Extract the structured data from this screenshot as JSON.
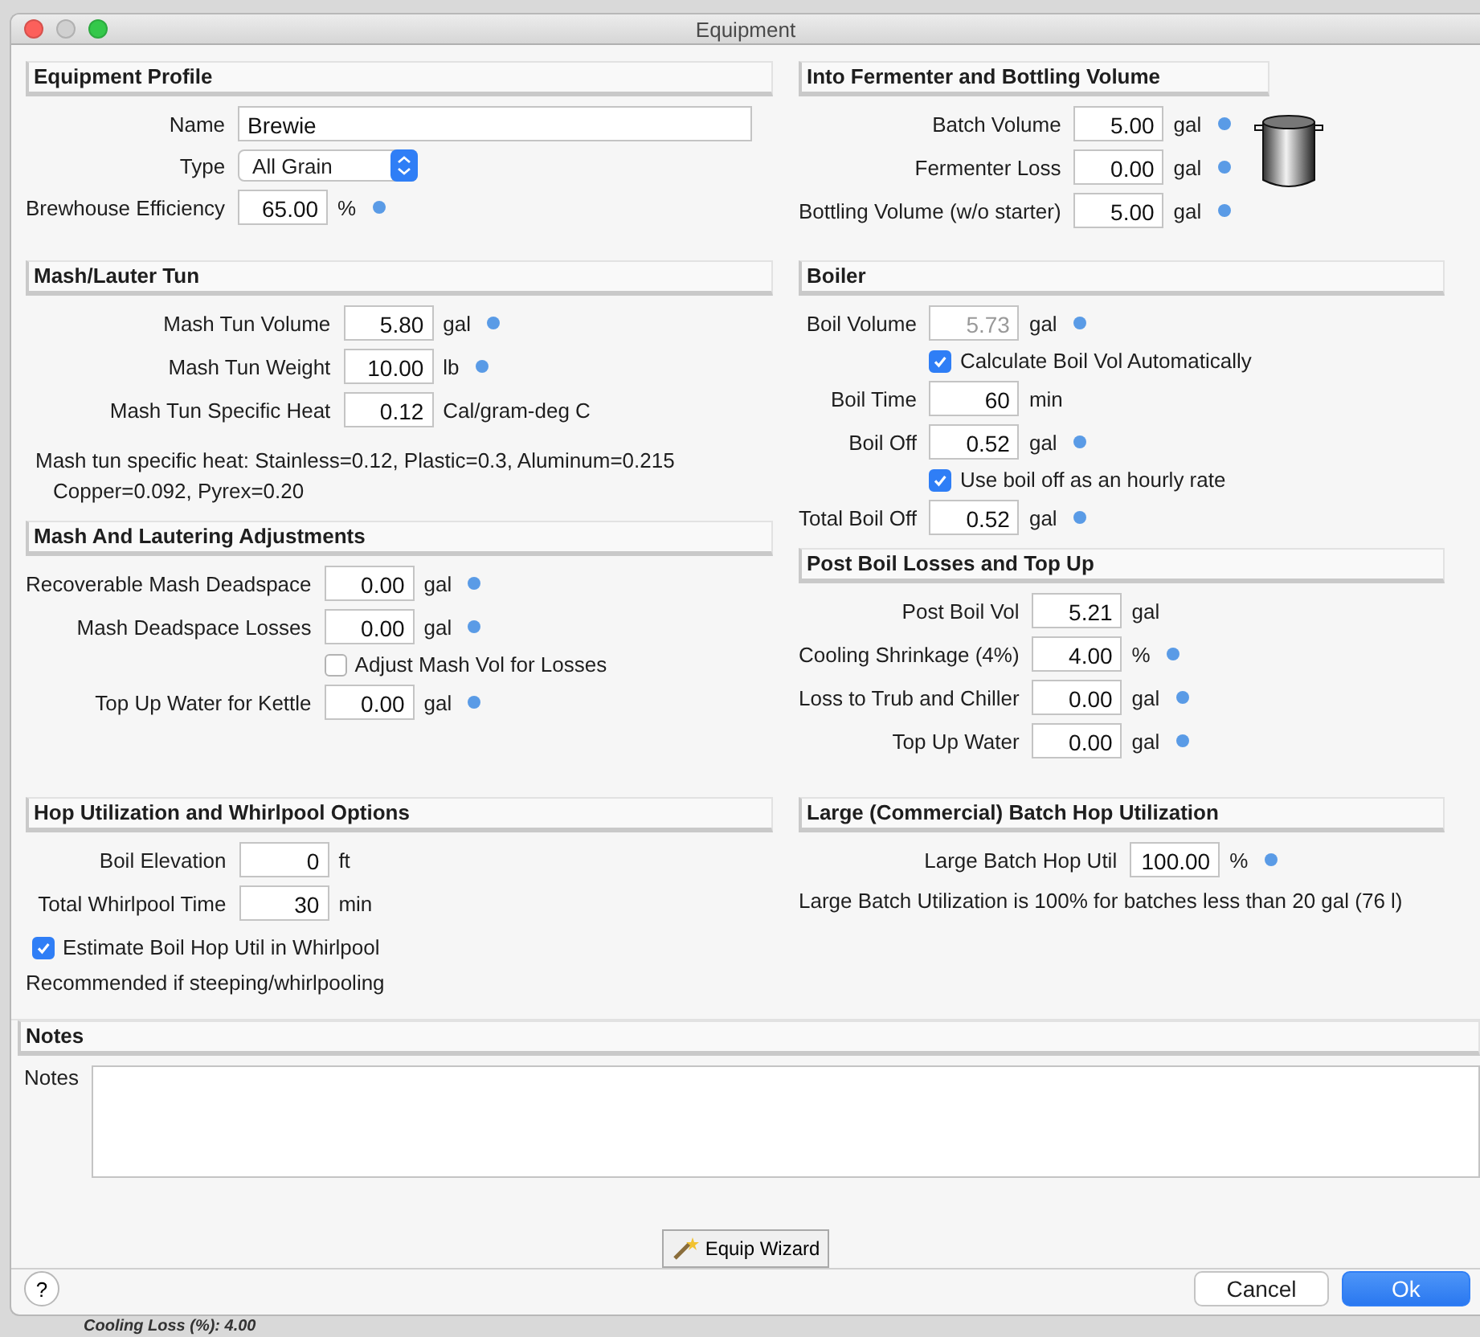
{
  "window": {
    "title": "Equipment"
  },
  "bands": [
    {
      "left": [
        {
          "title": "Equipment Profile",
          "kind": "plain",
          "rows": [
            {
              "kind": "text_field",
              "label": "Name",
              "value": "Brewie"
            },
            {
              "kind": "select",
              "label": "Type",
              "value": "All Grain"
            },
            {
              "kind": "field",
              "label": "Brewhouse Efficiency",
              "value": "65.00",
              "unit": "%",
              "dot": true,
              "disabled": false
            }
          ]
        }
      ],
      "right": [
        {
          "title": "Into Fermenter and Bottling Volume",
          "kind": "pot",
          "rows": [
            {
              "kind": "field",
              "label": "Batch Volume",
              "value": "5.00",
              "unit": "gal",
              "dot": true,
              "disabled": false
            },
            {
              "kind": "field",
              "label": "Fermenter Loss",
              "value": "0.00",
              "unit": "gal",
              "dot": true,
              "disabled": false
            },
            {
              "kind": "field",
              "label": "Bottling Volume (w/o starter)",
              "value": "5.00",
              "unit": "gal",
              "dot": true,
              "disabled": false
            }
          ]
        }
      ]
    },
    {
      "left": [
        {
          "title": "Mash/Lauter Tun",
          "kind": "plain",
          "rows": [
            {
              "kind": "field",
              "label": "Mash Tun Volume",
              "value": "5.80",
              "unit": "gal",
              "dot": true,
              "disabled": false
            },
            {
              "kind": "field",
              "label": "Mash Tun Weight",
              "value": "10.00",
              "unit": "lb",
              "dot": true,
              "disabled": false
            },
            {
              "kind": "field",
              "label": "Mash Tun Specific Heat",
              "value": "0.12",
              "unit": "Cal/gram-deg C",
              "dot": false,
              "disabled": false
            },
            {
              "kind": "note",
              "text": "Mash tun specific heat: Stainless=0.12, Plastic=0.3, Aluminum=0.215"
            },
            {
              "kind": "note",
              "text": "Copper=0.092, Pyrex=0.20"
            }
          ]
        },
        {
          "title": "Mash And Lautering Adjustments",
          "kind": "plain",
          "rows": [
            {
              "kind": "field",
              "label": "Recoverable Mash Deadspace",
              "value": "0.00",
              "unit": "gal",
              "dot": true,
              "disabled": false
            },
            {
              "kind": "field",
              "label": "Mash Deadspace Losses",
              "value": "0.00",
              "unit": "gal",
              "dot": true,
              "disabled": false
            },
            {
              "kind": "checkbox",
              "label": "Adjust Mash Vol for Losses",
              "checked": false
            },
            {
              "kind": "field",
              "label": "Top Up Water for Kettle",
              "value": "0.00",
              "unit": "gal",
              "dot": true,
              "disabled": false
            }
          ]
        }
      ],
      "right": [
        {
          "title": "Boiler",
          "kind": "plain",
          "rows": [
            {
              "kind": "field",
              "label": "Boil Volume",
              "value": "5.73",
              "unit": "gal",
              "dot": true,
              "disabled": true
            },
            {
              "kind": "checkbox",
              "label": "Calculate Boil Vol Automatically",
              "checked": true
            },
            {
              "kind": "field",
              "label": "Boil Time",
              "value": "60",
              "unit": "min",
              "dot": false,
              "disabled": false
            },
            {
              "kind": "field",
              "label": "Boil Off",
              "value": "0.52",
              "unit": "gal",
              "dot": true,
              "disabled": false
            },
            {
              "kind": "checkbox",
              "label": "Use boil off as an hourly rate",
              "checked": true
            },
            {
              "kind": "field",
              "label": "Total Boil Off",
              "value": "0.52",
              "unit": "gal",
              "dot": true,
              "disabled": false
            }
          ]
        },
        {
          "title": "Post Boil Losses and Top Up",
          "kind": "plain",
          "rows": [
            {
              "kind": "field",
              "label": "Post Boil Vol",
              "value": "5.21",
              "unit": "gal",
              "dot": false,
              "disabled": false
            },
            {
              "kind": "field",
              "label": "Cooling Shrinkage (4%)",
              "value": "4.00",
              "unit": "%",
              "dot": true,
              "disabled": false
            },
            {
              "kind": "field",
              "label": "Loss to Trub and Chiller",
              "value": "0.00",
              "unit": "gal",
              "dot": true,
              "disabled": false
            },
            {
              "kind": "field",
              "label": "Top Up Water",
              "value": "0.00",
              "unit": "gal",
              "dot": true,
              "disabled": false
            }
          ]
        }
      ]
    },
    {
      "left": [
        {
          "title": "Hop Utilization and Whirlpool Options",
          "kind": "plain",
          "rows": [
            {
              "kind": "field",
              "label": "Boil Elevation",
              "value": "0",
              "unit": "ft",
              "dot": false,
              "disabled": false
            },
            {
              "kind": "field",
              "label": "Total Whirlpool Time",
              "value": "30",
              "unit": "min",
              "dot": false,
              "disabled": false
            },
            {
              "kind": "checkbox_left",
              "label": "Estimate Boil Hop Util in Whirlpool",
              "checked": true
            },
            {
              "kind": "note_left",
              "text": "Recommended if steeping/whirlpooling"
            }
          ]
        }
      ],
      "right": [
        {
          "title": "Large (Commercial) Batch Hop Utilization",
          "kind": "plain",
          "rows": [
            {
              "kind": "field",
              "label": "Large Batch Hop Util",
              "value": "100.00",
              "unit": "%",
              "dot": true,
              "disabled": false
            },
            {
              "kind": "note_left",
              "text": "Large Batch Utilization is 100% for batches less than 20 gal (76 l)"
            }
          ]
        }
      ]
    }
  ],
  "notes": {
    "title": "Notes",
    "label": "Notes"
  },
  "wizard_button": "Equip Wizard",
  "footer": {
    "help": "?",
    "buttons": [
      {
        "label": "Cancel",
        "primary": false
      },
      {
        "label": "Ok",
        "primary": true
      }
    ]
  },
  "background_text": "Cooling Loss (%): 4.00"
}
